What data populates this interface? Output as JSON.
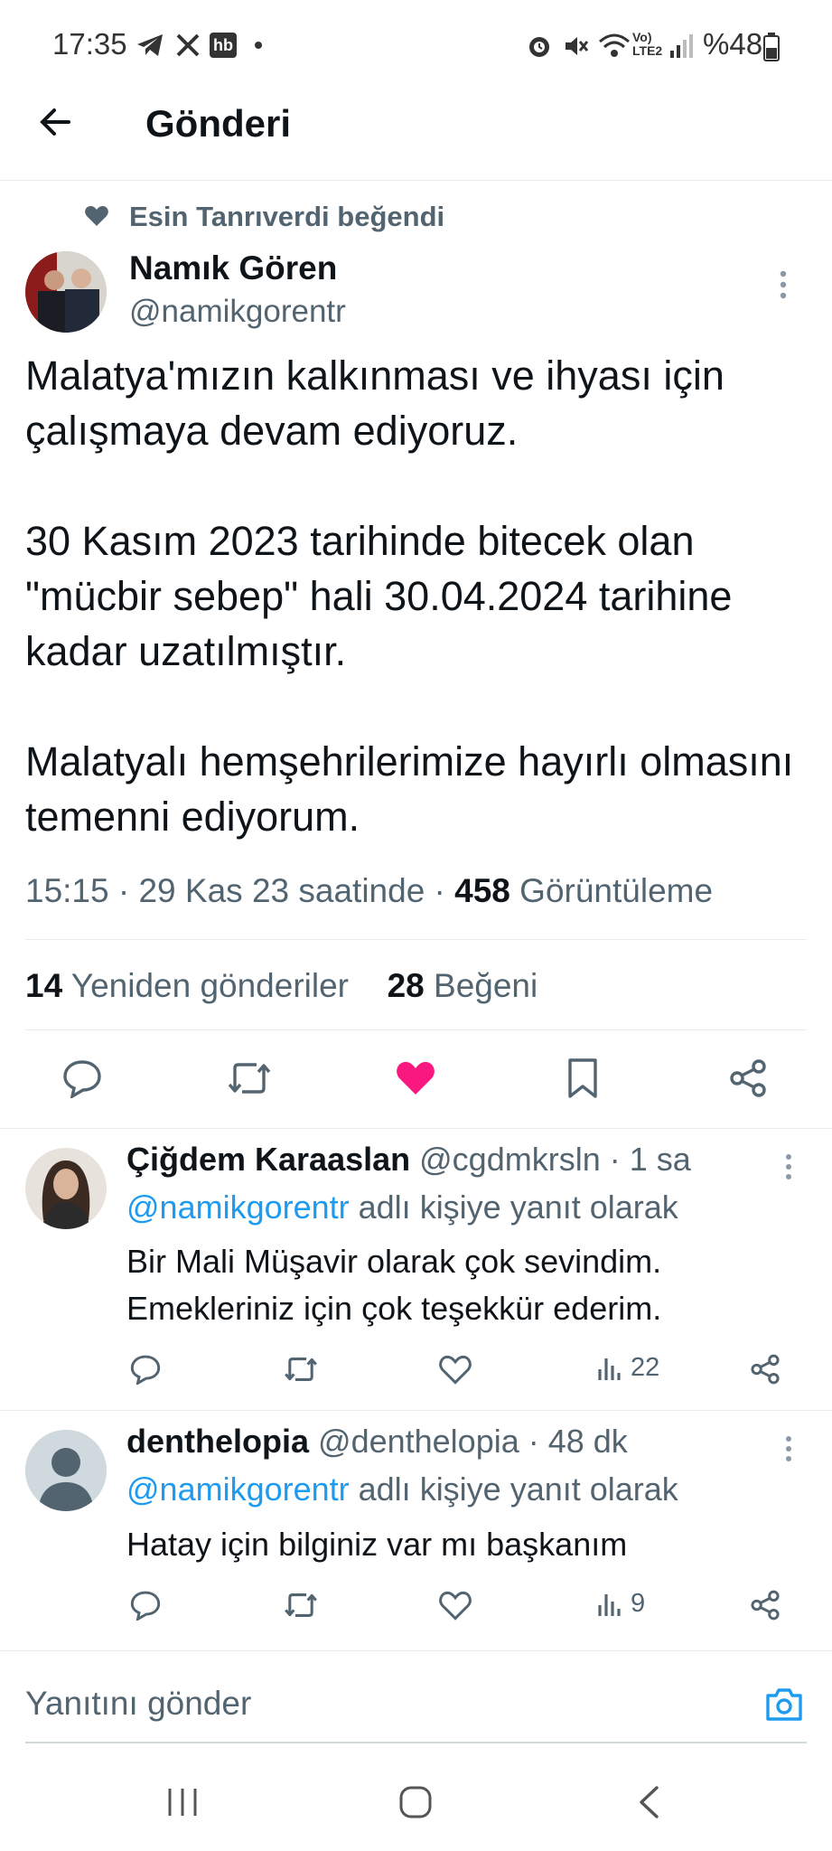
{
  "status_bar": {
    "time": "17:35",
    "right_text": "%48"
  },
  "header": {
    "title": "Gönderi"
  },
  "tweet": {
    "liked_by": "Esin Tanrıverdi beğendi",
    "author_name": "Namık Gören",
    "author_handle": "@namikgorentr",
    "paragraphs": [
      "Malatya'mızın kalkınması ve ihyası için çalışmaya devam ediyoruz.",
      "30 Kasım 2023 tarihinde bitecek olan \"mücbir sebep\" hali 30.04.2024 tarihine kadar uzatılmıştır.",
      "Malatyalı hemşehrilerimize hayırlı olmasını temenni ediyorum."
    ],
    "meta_time": "15:15 · 29 Kas 23 saatinde · ",
    "views_count": "458",
    "views_label": " Görüntüleme",
    "retweets_count": "14",
    "retweets_label": "Yeniden gönderiler",
    "likes_count": "28",
    "likes_label": "Beğeni"
  },
  "replies": [
    {
      "name": "Çiğdem Karaaslan",
      "meta": "@cgdmkrsln · 1 sa",
      "reply_to_handle": "@namikgorentr",
      "reply_to_suffix": " adlı kişiye yanıt olarak",
      "lines": [
        "Bir Mali Müşavir olarak çok sevindim.",
        "Emekleriniz için çok teşekkür ederim."
      ],
      "views": "22"
    },
    {
      "name": "denthelopia",
      "meta": "@denthelopia · 48 dk",
      "reply_to_handle": "@namikgorentr",
      "reply_to_suffix": " adlı kişiye yanıt olarak",
      "lines": [
        "Hatay için bilginiz var mı başkanım"
      ],
      "views": "9"
    }
  ],
  "compose": {
    "placeholder": "Yanıtını gönder"
  },
  "colors": {
    "accent": "#1d9bf0",
    "like": "#f91880",
    "muted": "#536471"
  }
}
